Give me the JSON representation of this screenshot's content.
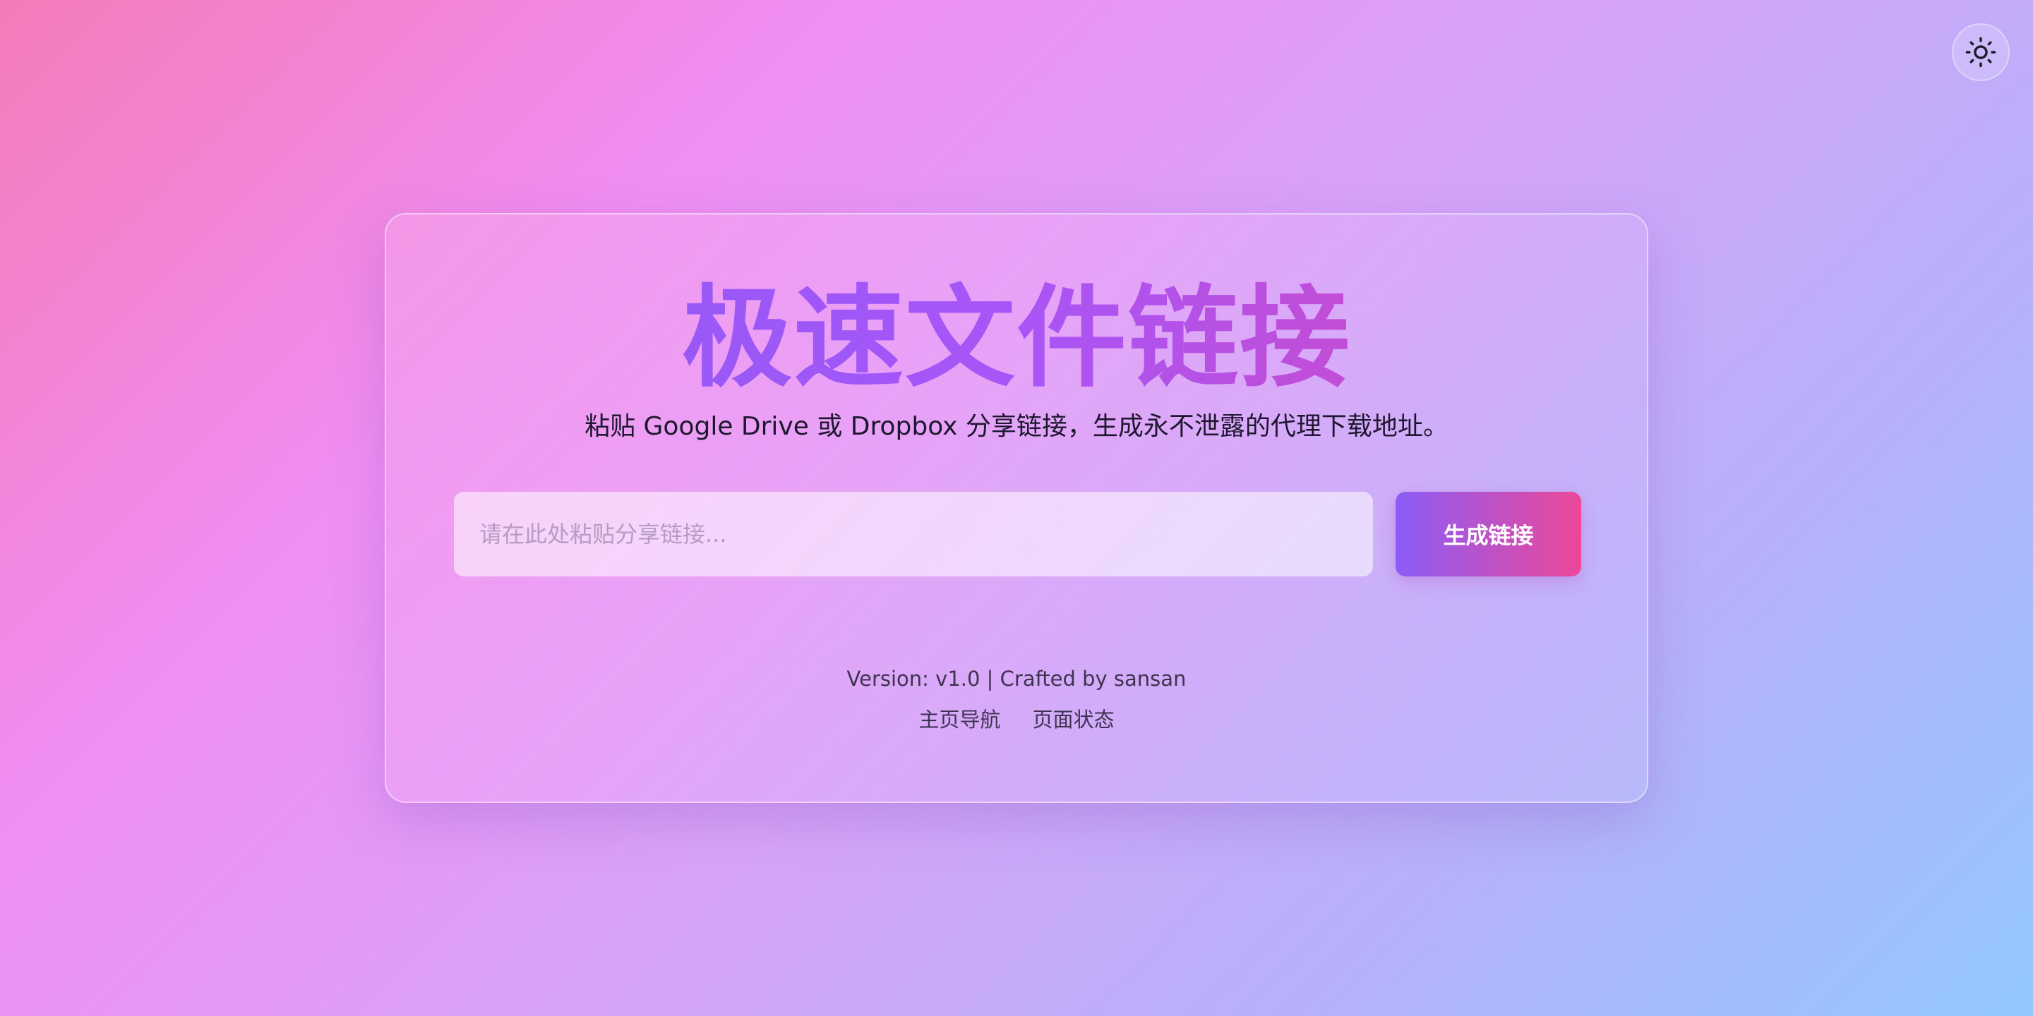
{
  "header": {
    "theme_toggle_icon": "sun-icon"
  },
  "card": {
    "title": "极速文件链接",
    "subtitle": "粘贴 Google Drive 或 Dropbox 分享链接，生成永不泄露的代理下载地址。",
    "input": {
      "value": "",
      "placeholder": "请在此处粘贴分享链接..."
    },
    "generate_label": "生成链接",
    "footer": {
      "version": "Version: v1.0 | Crafted by sansan",
      "links": [
        {
          "label": "主页导航"
        },
        {
          "label": "页面状态"
        }
      ]
    }
  },
  "colors": {
    "title_gradient_start": "#8b5cf6",
    "title_gradient_end": "#d946b9",
    "button_gradient_start": "#8b5cf6",
    "button_gradient_end": "#ec4899"
  }
}
